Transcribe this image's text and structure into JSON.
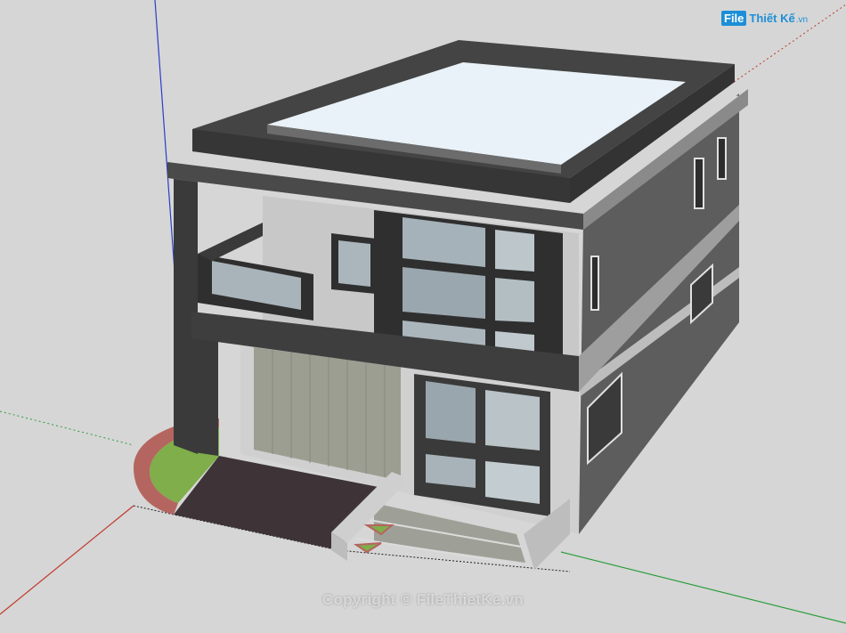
{
  "app": {
    "view": "3D model viewport"
  },
  "logo": {
    "badge": "File",
    "name": "Thiết Kế",
    "tld": ".vn"
  },
  "watermark": {
    "text": "Copyright © FileThietKe.vn"
  },
  "colors": {
    "background": "#d6d6d6",
    "axis_red": "#c0392b",
    "axis_green": "#2e9e3e",
    "axis_blue": "#2c3ec8",
    "dark_frame": "#3a3a3a",
    "wall_gray": "#6b6b6b",
    "light_wall": "#c8c8c8",
    "roof_slab": "#e9f2f8",
    "brick_border": "#b5655f",
    "lawn": "#7fae4a"
  },
  "model": {
    "type": "two-storey house",
    "features": [
      "flat roof with parapet",
      "balcony",
      "large grid window",
      "glass entry door",
      "front steps",
      "curved planter"
    ]
  }
}
